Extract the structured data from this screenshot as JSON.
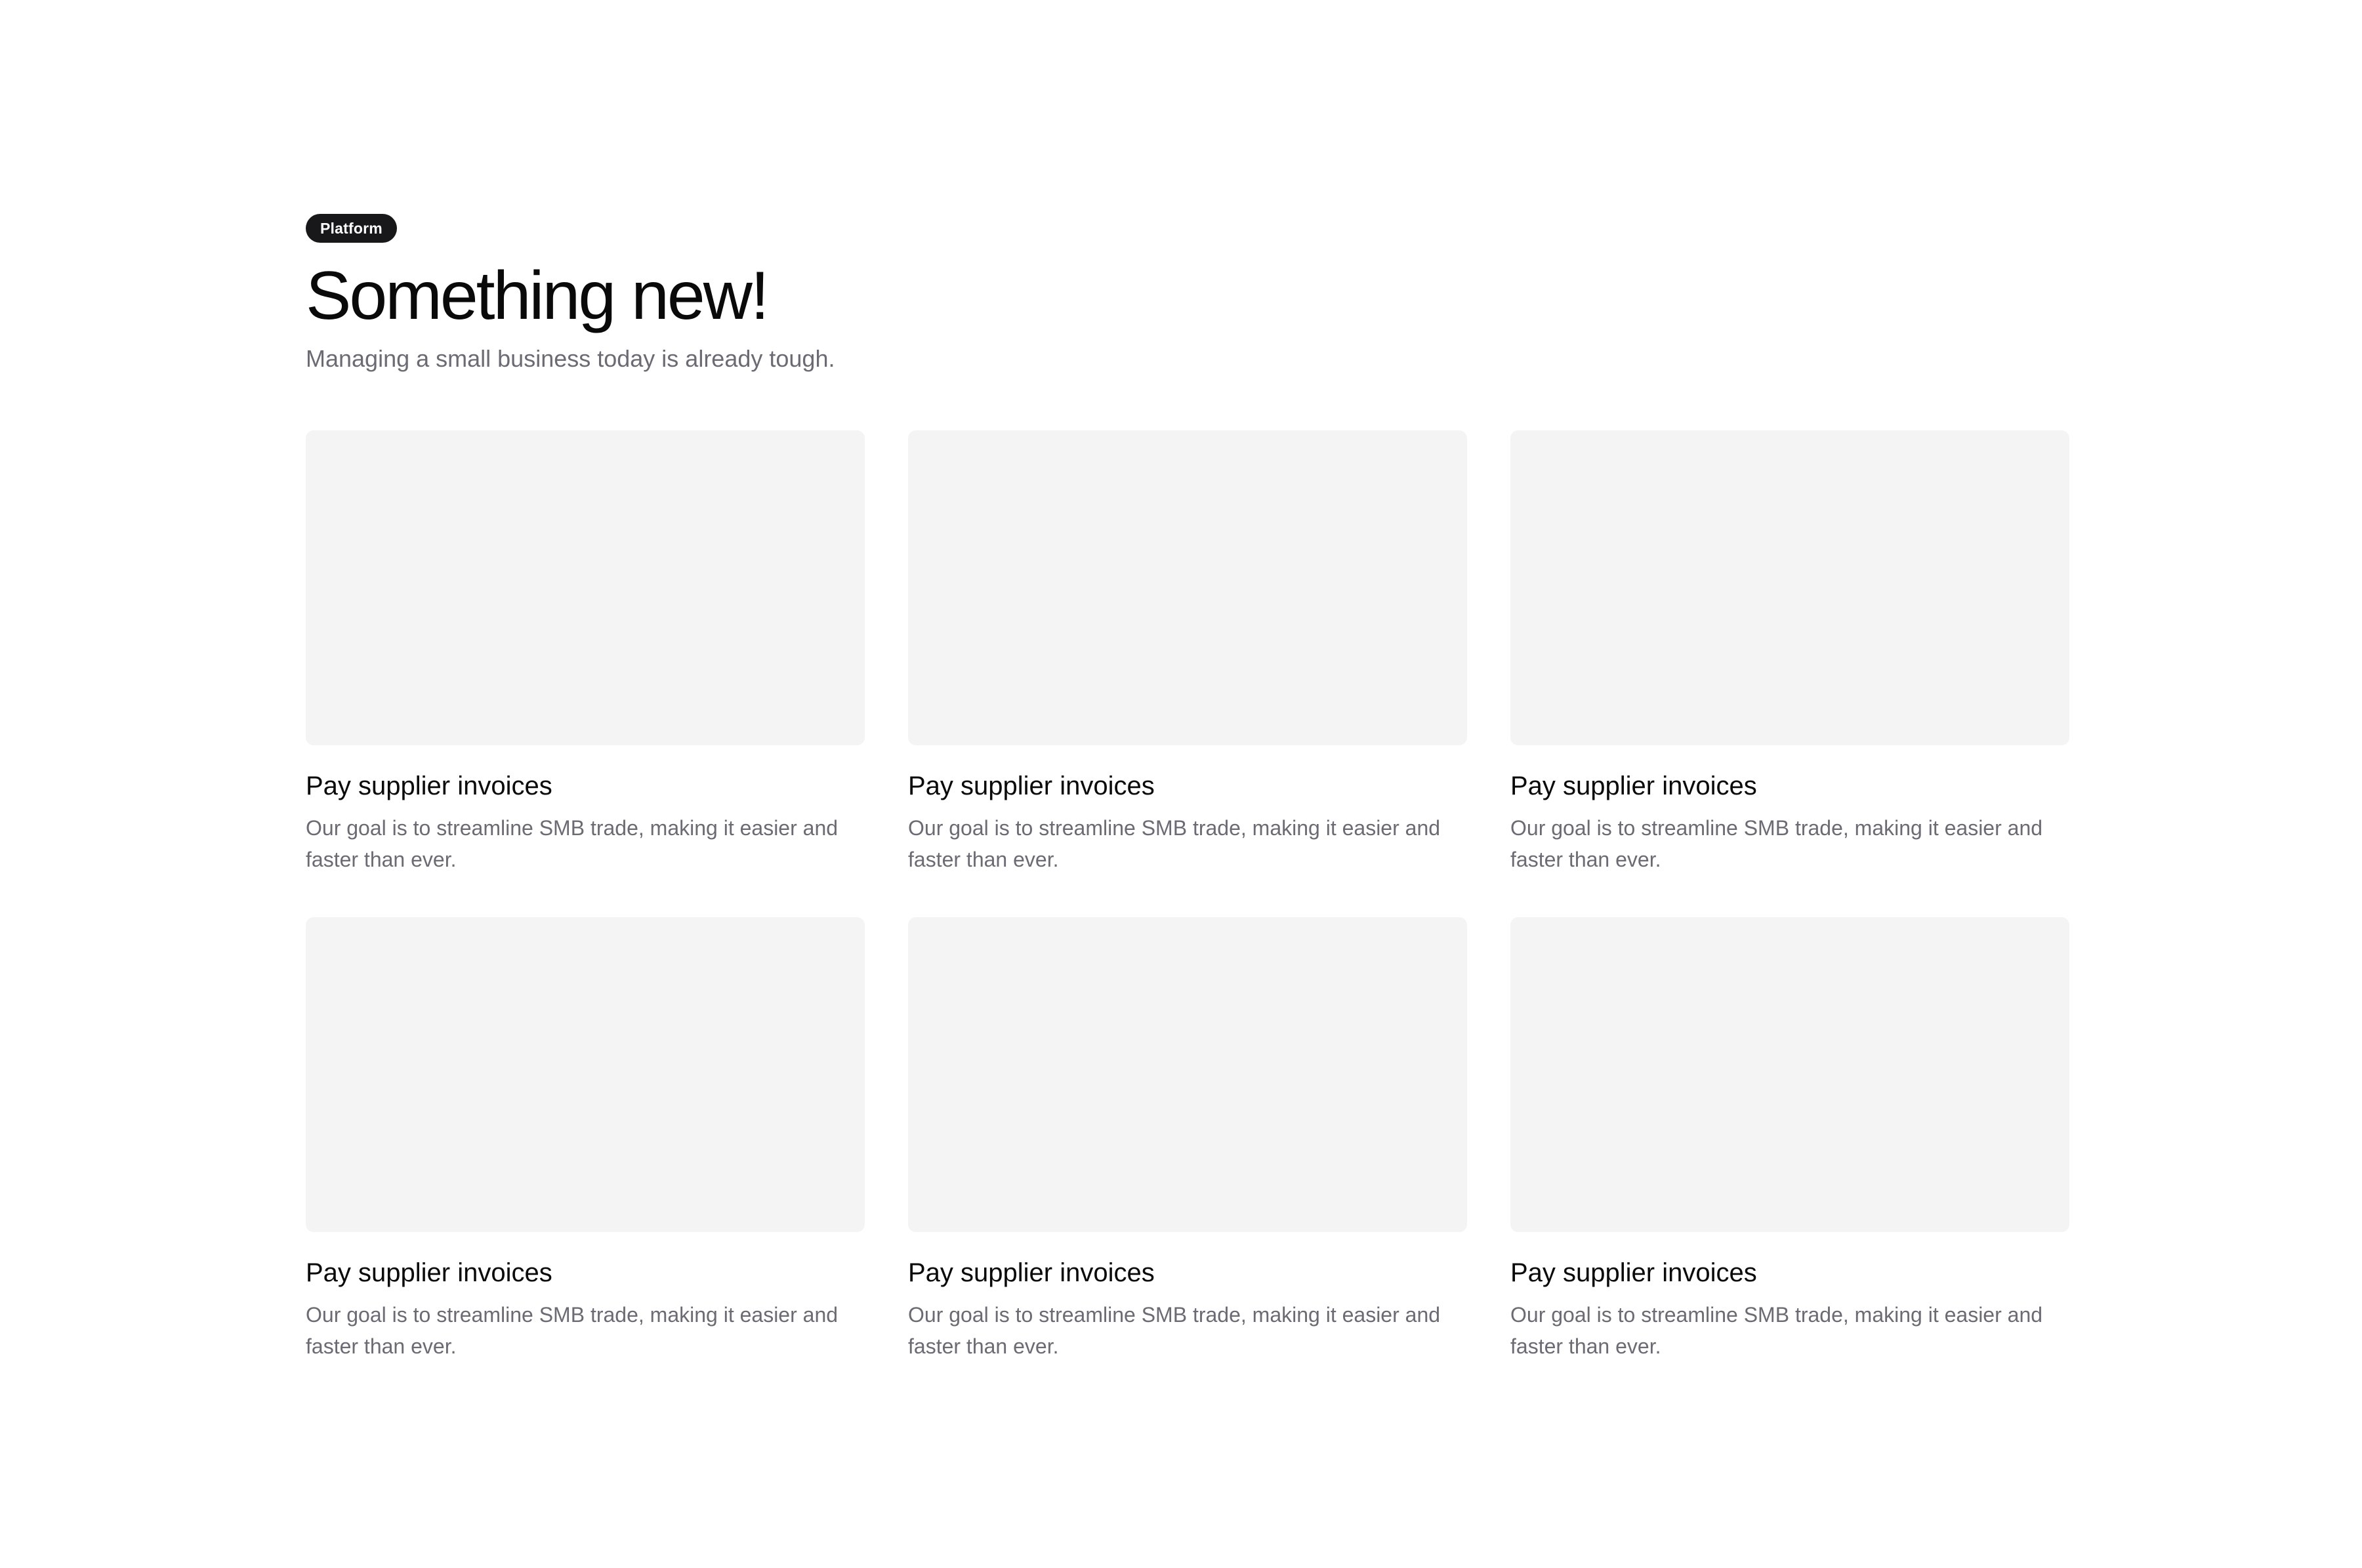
{
  "header": {
    "badge": "Platform",
    "title": "Something new!",
    "subtitle": "Managing a small business today is already tough."
  },
  "cards": [
    {
      "title": "Pay supplier invoices",
      "description": "Our goal is to streamline SMB trade, making it easier and faster than ever."
    },
    {
      "title": "Pay supplier invoices",
      "description": "Our goal is to streamline SMB trade, making it easier and faster than ever."
    },
    {
      "title": "Pay supplier invoices",
      "description": "Our goal is to streamline SMB trade, making it easier and faster than ever."
    },
    {
      "title": "Pay supplier invoices",
      "description": "Our goal is to streamline SMB trade, making it easier and faster than ever."
    },
    {
      "title": "Pay supplier invoices",
      "description": "Our goal is to streamline SMB trade, making it easier and faster than ever."
    },
    {
      "title": "Pay supplier invoices",
      "description": "Our goal is to streamline SMB trade, making it easier and faster than ever."
    }
  ],
  "colors": {
    "badge_bg": "#18181b",
    "placeholder_bg": "#f4f4f4",
    "muted_text": "#6b6b73"
  }
}
